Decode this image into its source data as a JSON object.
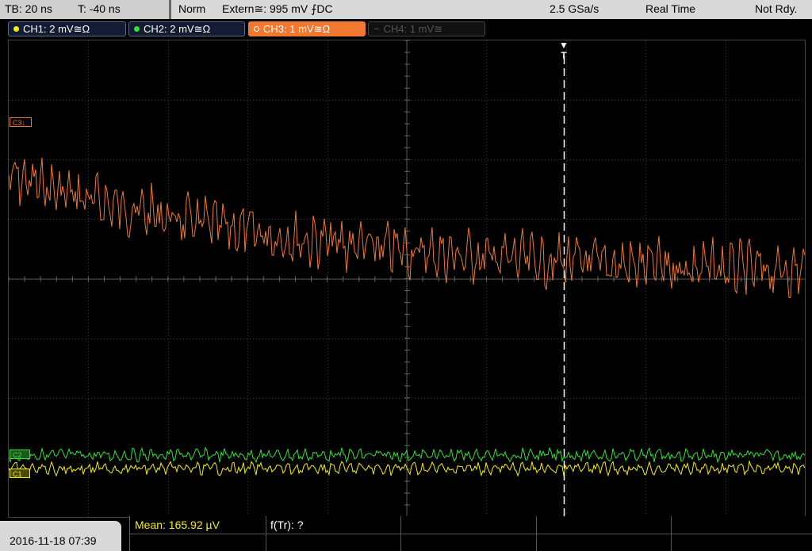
{
  "topbar": {
    "timebase": "TB: 20 ns",
    "trigger_time": "T: -40 ns",
    "trigger_mode": "Norm",
    "trigger_source": "Extern≅: 995 mV ⨍DC",
    "sample_rate": "2.5 GSa/s",
    "acq_mode": "Real Time",
    "status": "Not Rdy."
  },
  "channels": [
    {
      "label": "CH1: 2 mV≅Ω",
      "color": "#f5f000",
      "state": "on"
    },
    {
      "label": "CH2: 2 mV≅Ω",
      "color": "#33e033",
      "state": "on"
    },
    {
      "label": "CH3: 1 mV≅Ω",
      "color": "#f07830",
      "state": "selected"
    },
    {
      "label": "CH4: 1 mV≅",
      "color": "#555555",
      "state": "off"
    }
  ],
  "markers": {
    "ch3": "C3↓",
    "ch2": "C2",
    "ch1": "C1",
    "trigger": "T"
  },
  "footer": {
    "datetime": "2016-11-18 07:39",
    "mean": "Mean: 165.92 µV",
    "ftr": "f(Tr): ?"
  },
  "colors": {
    "ch1": "#f5f000",
    "ch2": "#33e033",
    "ch3": "#f07830"
  }
}
